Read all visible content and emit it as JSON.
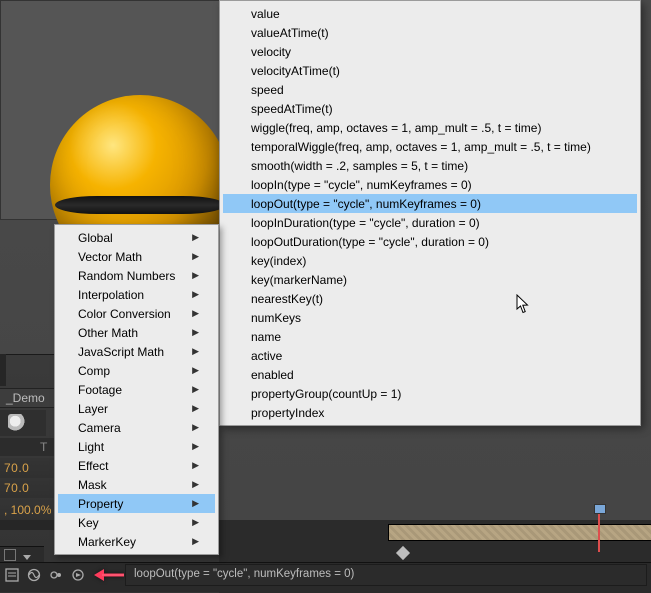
{
  "menu1": {
    "items": [
      {
        "label": "Global"
      },
      {
        "label": "Vector Math"
      },
      {
        "label": "Random Numbers"
      },
      {
        "label": "Interpolation"
      },
      {
        "label": "Color Conversion"
      },
      {
        "label": "Other Math"
      },
      {
        "label": "JavaScript Math"
      },
      {
        "label": "Comp"
      },
      {
        "label": "Footage"
      },
      {
        "label": "Layer"
      },
      {
        "label": "Camera"
      },
      {
        "label": "Light"
      },
      {
        "label": "Effect"
      },
      {
        "label": "Mask"
      },
      {
        "label": "Property"
      },
      {
        "label": "Key"
      },
      {
        "label": "MarkerKey"
      }
    ],
    "selected_index": 14
  },
  "menu2": {
    "items": [
      {
        "label": "value"
      },
      {
        "label": "valueAtTime(t)"
      },
      {
        "label": "velocity"
      },
      {
        "label": "velocityAtTime(t)"
      },
      {
        "label": "speed"
      },
      {
        "label": "speedAtTime(t)"
      },
      {
        "label": "wiggle(freq, amp, octaves = 1, amp_mult = .5, t = time)"
      },
      {
        "label": "temporalWiggle(freq, amp, octaves = 1, amp_mult = .5, t = time)"
      },
      {
        "label": "smooth(width = .2, samples = 5, t = time)"
      },
      {
        "label": "loopIn(type = \"cycle\", numKeyframes = 0)"
      },
      {
        "label": "loopOut(type = \"cycle\", numKeyframes = 0)"
      },
      {
        "label": "loopInDuration(type = \"cycle\", duration = 0)"
      },
      {
        "label": "loopOutDuration(type = \"cycle\", duration = 0)"
      },
      {
        "label": "key(index)"
      },
      {
        "label": "key(markerName)"
      },
      {
        "label": "nearestKey(t)"
      },
      {
        "label": "numKeys"
      },
      {
        "label": "name"
      },
      {
        "label": "active"
      },
      {
        "label": "enabled"
      },
      {
        "label": "propertyGroup(countUp = 1)"
      },
      {
        "label": "propertyIndex"
      }
    ],
    "selected_index": 10
  },
  "timeline": {
    "tab_label": "_Demo",
    "ruler_label": "T",
    "row_values": [
      "70.0",
      "70.0",
      ", 100.0%"
    ]
  },
  "expression_field": "loopOut(type = \"cycle\", numKeyframes = 0)",
  "colors": {
    "menu_highlight": "#90c8f6",
    "orange_text": "#d9a24a",
    "cti_red": "#dd4d4d"
  }
}
